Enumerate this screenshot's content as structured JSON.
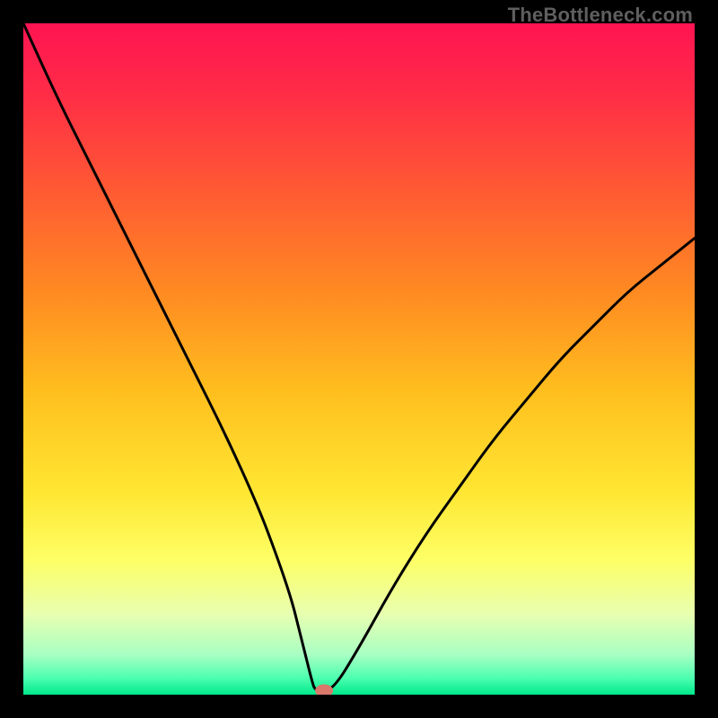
{
  "watermark": "TheBottleneck.com",
  "chart_data": {
    "type": "line",
    "title": "",
    "xlabel": "",
    "ylabel": "",
    "xlim": [
      0,
      100
    ],
    "ylim": [
      0,
      100
    ],
    "grid": false,
    "legend": false,
    "series": [
      {
        "name": "curve",
        "x": [
          0,
          5,
          10,
          15,
          20,
          25,
          30,
          35,
          38,
          40,
          41,
          42,
          43,
          43.5,
          46,
          50,
          55,
          60,
          65,
          70,
          75,
          80,
          85,
          90,
          95,
          100
        ],
        "y": [
          100,
          89,
          79,
          69,
          59,
          49,
          39,
          28,
          20,
          14,
          10,
          6,
          2,
          0.5,
          0.5,
          7,
          16,
          24,
          31,
          38,
          44,
          50,
          55,
          60,
          64,
          68
        ]
      }
    ],
    "marker": {
      "x": 44.8,
      "y": 0.6
    },
    "gradient_stops": [
      {
        "offset": 0.0,
        "color": "#ff1452"
      },
      {
        "offset": 0.1,
        "color": "#ff2b47"
      },
      {
        "offset": 0.25,
        "color": "#ff5a33"
      },
      {
        "offset": 0.4,
        "color": "#ff8a22"
      },
      {
        "offset": 0.55,
        "color": "#ffbf1e"
      },
      {
        "offset": 0.7,
        "color": "#ffe733"
      },
      {
        "offset": 0.8,
        "color": "#fdff66"
      },
      {
        "offset": 0.88,
        "color": "#e8ffb0"
      },
      {
        "offset": 0.94,
        "color": "#a9ffc3"
      },
      {
        "offset": 0.975,
        "color": "#4dffb0"
      },
      {
        "offset": 1.0,
        "color": "#00e88b"
      }
    ]
  }
}
